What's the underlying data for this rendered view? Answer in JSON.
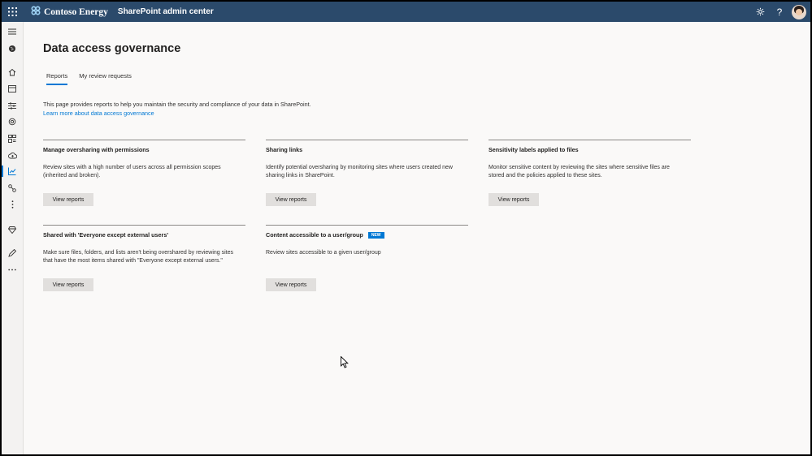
{
  "topbar": {
    "brand_name": "Contoso Energy",
    "app_name": "SharePoint admin center",
    "icons": [
      "waffle-icon",
      "settings-icon",
      "help-icon"
    ],
    "color": "#2b4a6b"
  },
  "leftnav": {
    "icons": [
      "hamburger-icon",
      "globe-icon",
      "home-icon",
      "sites-icon",
      "policies-icon",
      "settings-icon",
      "content-services-icon",
      "migration-icon",
      "reports-icon",
      "connections-icon",
      "more-vertical-icon",
      "advanced-icon",
      "customize-navigation-icon",
      "more-horizontal-icon"
    ],
    "active": "reports-icon"
  },
  "page": {
    "title": "Data access governance",
    "tabs": [
      {
        "label": "Reports",
        "active": true
      },
      {
        "label": "My review requests",
        "active": false
      }
    ],
    "description": "This page provides reports to help you maintain the security and compliance of your data in SharePoint.",
    "learn_more": "Learn more about data access governance"
  },
  "cards": [
    {
      "title": "Manage oversharing with permissions",
      "desc_line1": "Review sites with a high number of users across all permission scopes",
      "desc_line2": "(inherited and broken).",
      "button": "View reports"
    },
    {
      "title": "Sharing links",
      "desc_line1": "Identify potential oversharing by monitoring sites where users created new",
      "desc_line2": "sharing links in SharePoint.",
      "button": "View reports"
    },
    {
      "title": "Sensitivity labels applied to files",
      "desc_line1": "Monitor sensitive content by reviewing the sites where sensitive files are",
      "desc_line2": "stored and the policies applied to these sites.",
      "button": "View reports"
    },
    {
      "title": "Shared with 'Everyone except external users'",
      "desc_line1": "Make sure files, folders, and lists aren't being overshared by reviewing sites",
      "desc_line2": "that have the most items shared with \"Everyone except external users.\"",
      "button": "View reports"
    },
    {
      "title": "Content accessible to a user/group",
      "badge": "NEW",
      "desc_line1": "Review sites accessible to a given user/group",
      "desc_line2": "",
      "button": "View reports"
    }
  ],
  "colors": {
    "accent": "#0078d4",
    "button_bg": "#e1dfdd"
  }
}
